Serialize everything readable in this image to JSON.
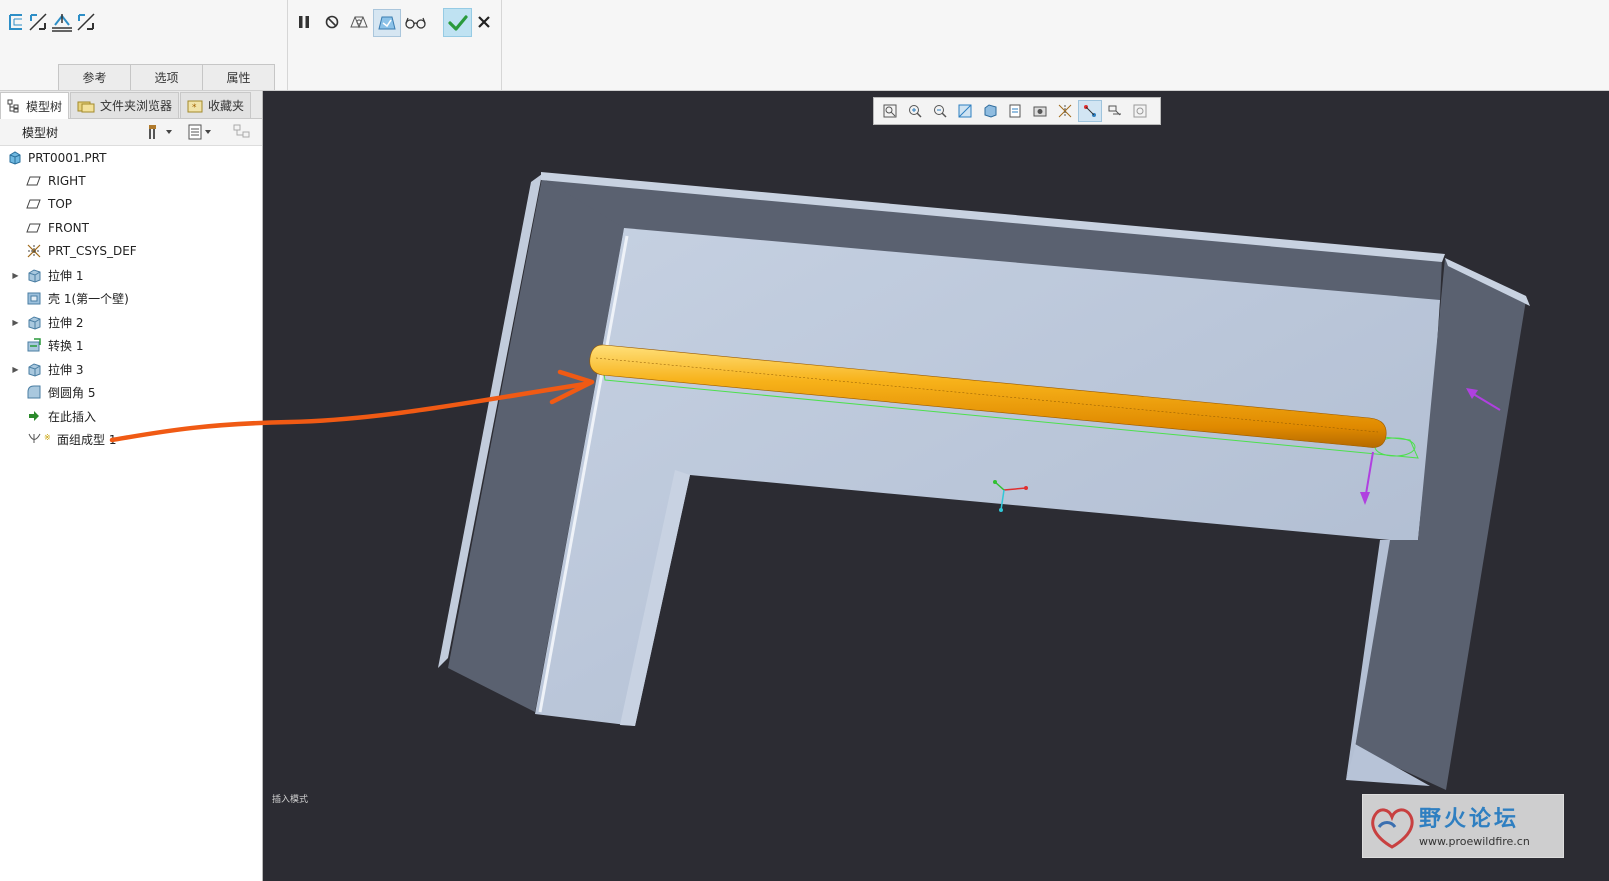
{
  "ribbon": {
    "tabs": [
      "参考",
      "选项",
      "属性"
    ],
    "left_icons": [
      "offset-surface-icon",
      "direction-arrow-icon",
      "sketch-surface-icon",
      "direction-arrow-icon"
    ],
    "right_icons": [
      "pause-icon",
      "stop-icon",
      "preview-icon",
      "feature-preview-icon",
      "glasses-icon"
    ]
  },
  "panel": {
    "tabs": [
      {
        "label": "模型树",
        "icon": "model-tree-icon"
      },
      {
        "label": "文件夹浏览器",
        "icon": "folder-icon"
      },
      {
        "label": "收藏夹",
        "icon": "favorites-icon"
      }
    ],
    "header_title": "模型树"
  },
  "tree": [
    {
      "label": "PRT0001.PRT",
      "icon": "part-icon",
      "expandable": false,
      "indent": 0
    },
    {
      "label": "RIGHT",
      "icon": "datum-plane-icon",
      "expandable": false,
      "indent": 1
    },
    {
      "label": "TOP",
      "icon": "datum-plane-icon",
      "expandable": false,
      "indent": 1
    },
    {
      "label": "FRONT",
      "icon": "datum-plane-icon",
      "expandable": false,
      "indent": 1
    },
    {
      "label": "PRT_CSYS_DEF",
      "icon": "csys-icon",
      "expandable": false,
      "indent": 1
    },
    {
      "label": "拉伸 1",
      "icon": "extrude-icon",
      "expandable": true,
      "indent": 1
    },
    {
      "label": "壳 1(第一个壁)",
      "icon": "shell-icon",
      "expandable": false,
      "indent": 1
    },
    {
      "label": "拉伸 2",
      "icon": "extrude-icon",
      "expandable": true,
      "indent": 1
    },
    {
      "label": "转换 1",
      "icon": "convert-icon",
      "expandable": false,
      "indent": 1
    },
    {
      "label": "拉伸 3",
      "icon": "extrude-icon",
      "expandable": true,
      "indent": 1
    },
    {
      "label": "倒圆角 5",
      "icon": "round-icon",
      "expandable": false,
      "indent": 1
    },
    {
      "label": "在此插入",
      "icon": "insert-here-icon",
      "expandable": false,
      "indent": 1
    },
    {
      "label": "面组成型 1",
      "icon": "quilt-form-icon",
      "expandable": false,
      "indent": 1
    }
  ],
  "viewport": {
    "mode_text": "插入模式",
    "view_toolbar_icons": [
      "refit-icon",
      "zoom-in-icon",
      "zoom-out-icon",
      "repaint-icon",
      "display-style-icon",
      "saved-views-icon",
      "view-manager-icon",
      "datum-display-icon",
      "spin-center-icon",
      "annotation-display-icon",
      "appearance-icon"
    ]
  },
  "watermark": {
    "title": "野火论坛",
    "url": "www.proewildfire.cn"
  },
  "colors": {
    "viewport_bg": "#2c2c33",
    "part_face": "#b4c0d4",
    "part_side": "#5a6170",
    "highlight": "#f5a200",
    "annotation_arrow": "#f05a14",
    "drag_arrow": "#b040e0",
    "ok_button": "#2a9a3c"
  }
}
